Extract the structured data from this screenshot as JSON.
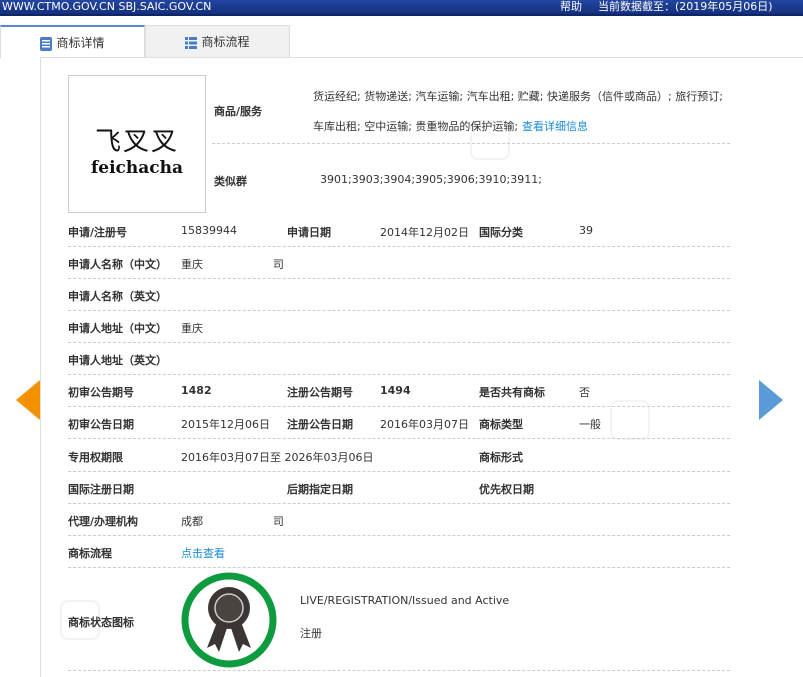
{
  "topbar": {
    "site": "WWW.CTMO.GOV.CN SBJ.SAIC.GOV.CN",
    "help": "帮助",
    "date": "当前数据截至：(2019年05月06日)"
  },
  "tabs": [
    {
      "label": "商标详情",
      "icon": "document-list-icon"
    },
    {
      "label": "商标流程",
      "icon": "list-icon"
    }
  ],
  "mark": {
    "cn": "飞叉叉",
    "en": "feichacha"
  },
  "goods": {
    "label": "商品/服务",
    "line1": "货运经纪; 货物递送; 汽车运输; 汽车出租; 贮藏; 快递服务（信件或商品）; 旅行预订;",
    "line2": "车库出租; 空中运输; 贵重物品的保护运输;",
    "link": "查看详细信息"
  },
  "similar": {
    "label": "类似群",
    "value": "3901;3903;3904;3905;3906;3910;3911;"
  },
  "rows": {
    "reg_no": {
      "label": "申请/注册号",
      "value": "15839944"
    },
    "app_date": {
      "label": "申请日期",
      "value": "2014年12月02日"
    },
    "intl_class": {
      "label": "国际分类",
      "value": "39"
    },
    "name_cn": {
      "label": "申请人名称（中文）",
      "value": "重庆                    司"
    },
    "name_en": {
      "label": "申请人名称（英文）"
    },
    "addr_cn": {
      "label": "申请人地址（中文）",
      "value": "重庆"
    },
    "addr_en": {
      "label": "申请人地址（英文）"
    },
    "prelim_no": {
      "label": "初审公告期号",
      "value": "1482"
    },
    "reg_pub_no": {
      "label": "注册公告期号",
      "value": "1494"
    },
    "shared": {
      "label": "是否共有商标",
      "value": "否"
    },
    "prelim_date": {
      "label": "初审公告日期",
      "value": "2015年12月06日"
    },
    "reg_pub_date": {
      "label": "注册公告日期",
      "value": "2016年03月07日"
    },
    "mark_type": {
      "label": "商标类型",
      "value": "一般"
    },
    "validity": {
      "label": "专用权期限",
      "value": "2016年03月07日至 2026年03月06日"
    },
    "mark_form": {
      "label": "商标形式"
    },
    "intl_reg_date": {
      "label": "国际注册日期"
    },
    "later_date": {
      "label": "后期指定日期"
    },
    "priority_date": {
      "label": "优先权日期"
    },
    "agent": {
      "label": "代理/办理机构",
      "value": "成都                    司"
    },
    "flow": {
      "label": "商标流程",
      "link": "点击查看"
    },
    "status": {
      "label": "商标状态图标",
      "en": "LIVE/REGISTRATION/Issued and Active",
      "cn": "注册"
    }
  },
  "colors": {
    "topbar": "#1a3a8a",
    "link": "#1a8ad4",
    "prev": "#f39200",
    "next": "#5a9ad8",
    "status_ring": "#0e9a3e"
  }
}
